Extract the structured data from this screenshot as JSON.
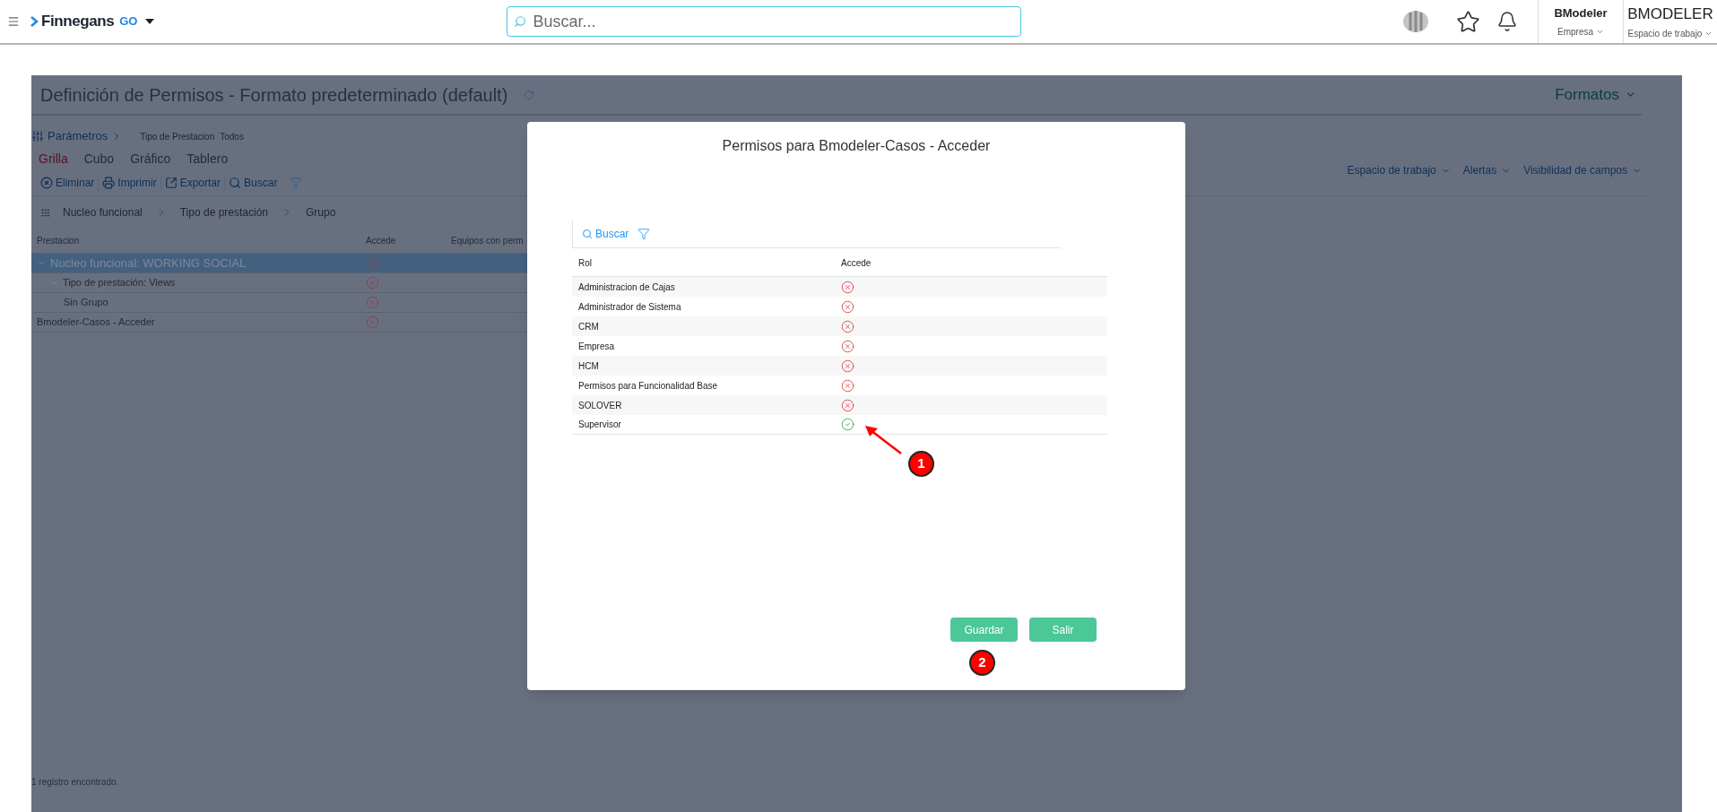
{
  "topbar": {
    "brand": "Finnegans",
    "brand_suffix": "GO",
    "search": {
      "placeholder": "Buscar..."
    },
    "company": {
      "name": "BModeler",
      "label": "Empresa"
    },
    "workspace": {
      "name": "BMODELER",
      "label": "Espacio de trabajo"
    }
  },
  "page": {
    "title": "Definición de Permisos - Formato predeterminado (default)",
    "formats": "Formatos",
    "parameters": {
      "label": "Parámetros",
      "filter_label": "Tipo de Prestacion",
      "filter_value": "Todos"
    },
    "view_tabs": [
      {
        "label": "Grilla",
        "selected": true
      },
      {
        "label": "Cubo",
        "selected": false
      },
      {
        "label": "Gráfico",
        "selected": false
      },
      {
        "label": "Tablero",
        "selected": false
      }
    ],
    "toolbar": [
      {
        "kind": "delete",
        "label": "Eliminar"
      },
      {
        "kind": "print",
        "label": "Imprimir"
      },
      {
        "kind": "export",
        "label": "Exportar"
      },
      {
        "kind": "search",
        "label": "Buscar"
      },
      {
        "kind": "filter"
      }
    ],
    "options": [
      "Espacio de trabajo",
      "Alertas",
      "Visibilidad de campos"
    ],
    "groupers": [
      "Nucleo funcional",
      "Tipo de prestación",
      "Grupo"
    ],
    "table": {
      "columns": [
        "Prestacion",
        "Accede",
        "Equipos con perm"
      ],
      "rows": [
        {
          "label": "Nucleo funcional: WORKING SOCIAL",
          "selected": true,
          "access": false,
          "children": [
            {
              "label": "Tipo de prestación: Views",
              "selected": false,
              "access": false,
              "children": [
                {
                  "label": "Sin Grupo",
                  "selected": false,
                  "access": false
                }
              ]
            }
          ]
        },
        {
          "label": "Bmodeler-Casos - Acceder",
          "selected": false,
          "access": false
        }
      ]
    },
    "footer": "1 registro encontrado."
  },
  "dialog": {
    "title": "Permisos para Bmodeler-Casos - Acceder",
    "search": "Buscar",
    "columns": [
      "Rol",
      "Accede"
    ],
    "rows": [
      {
        "role": "Administracion de Cajas",
        "access": false
      },
      {
        "role": "Administrador de Sistema",
        "access": false
      },
      {
        "role": "CRM",
        "access": false
      },
      {
        "role": "Empresa",
        "access": false
      },
      {
        "role": "HCM",
        "access": false
      },
      {
        "role": "Permisos para Funcionalidad Base",
        "access": false
      },
      {
        "role": "SOLOVER",
        "access": false
      },
      {
        "role": "Supervisor",
        "access": true
      }
    ],
    "buttons": [
      "Guardar",
      "Salir"
    ]
  },
  "annotations": [
    {
      "label": "1"
    },
    {
      "label": "2"
    }
  ]
}
